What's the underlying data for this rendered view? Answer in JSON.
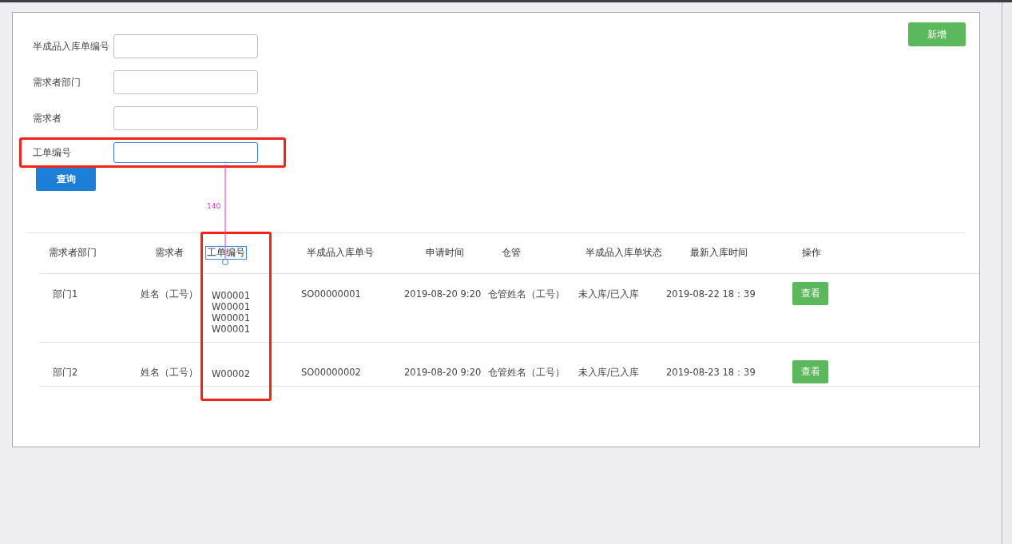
{
  "add_button": "新增",
  "filters": [
    {
      "label": "半成品入库单编号",
      "focused": false,
      "highlighted": false
    },
    {
      "label": "需求者部门",
      "focused": false,
      "highlighted": false
    },
    {
      "label": "需求者",
      "focused": false,
      "highlighted": false
    },
    {
      "label": "工单编号",
      "focused": true,
      "highlighted": true
    }
  ],
  "query_button": "查询",
  "annotation": {
    "measure_label": "140"
  },
  "table": {
    "columns": [
      {
        "label": "需求者部门",
        "highlighted": false
      },
      {
        "label": "需求者",
        "highlighted": false
      },
      {
        "label": "工单编号",
        "highlighted": true
      },
      {
        "label": "半成品入库单号",
        "highlighted": false
      },
      {
        "label": "申请时间",
        "highlighted": false
      },
      {
        "label": "仓管",
        "highlighted": false
      },
      {
        "label": "半成品入库单状态",
        "highlighted": false
      },
      {
        "label": "最新入库时间",
        "highlighted": false
      },
      {
        "label": "操作",
        "highlighted": false
      }
    ],
    "rows": [
      {
        "department": "部门1",
        "requester": "姓名（工号）",
        "work_orders": [
          "W00001",
          "W00001",
          "W00001",
          "W00001"
        ],
        "receipt_no": "SO00000001",
        "applied_at": "2019-08-20 9:20",
        "keeper": "仓管姓名（工号）",
        "status": "未入库/已入库",
        "latest_at": "2019-08-22 18：39",
        "action": "查看"
      },
      {
        "department": "部门2",
        "requester": "姓名（工号）",
        "work_orders": [
          "W00002"
        ],
        "receipt_no": "SO00000002",
        "applied_at": "2019-08-20 9:20",
        "keeper": "仓管姓名（工号）",
        "status": "未入库/已入库",
        "latest_at": "2019-08-23 18：39",
        "action": "查看"
      }
    ]
  }
}
